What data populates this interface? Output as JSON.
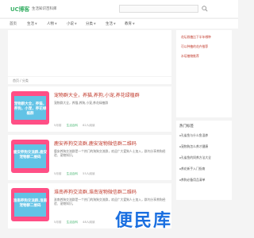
{
  "header": {
    "logo": "UC博客",
    "slogan": "生活知识百科库"
  },
  "nav": [
    "首页",
    "生活",
    "人物",
    "小说",
    "分类",
    "生活",
    "教育"
  ],
  "breadcrumb": "首页 / 分类",
  "cards": [
    {
      "thumb_text": "宠物群大全，养猫，养狗，小宠，养花绿植群",
      "title": "宠物群大全，养猫,养狗,小宠,养花绿植群",
      "desc": "宠物群大全，养猫,养狗,小宠,养花绿植群",
      "meta": [
        "5月前",
        "生活百科",
        "62人阅读"
      ]
    },
    {
      "thumb_text": "鹿安养狗交流群,鹿安宠物群二维码",
      "title": "鹿安养狗交流群,鹿安宠物微信群二维码",
      "desc": "鹿安养狗交流群是一个热门的狗狗交流群，欢迎广大爱狗人士加入，群内分享养狗经验、宠物知识。",
      "meta": [
        "5月前",
        "生活百科",
        "55人阅读"
      ]
    },
    {
      "thumb_text": "淮南养狗交流群,淮南宠物群二维码",
      "title": "淮南养狗交流群,淮南宠物微信群二维码",
      "desc": "淮南养狗交流群是一个热门的狗狗交流群，欢迎广大爱狗人士加入，群内分享养狗经验、宠物知识。",
      "meta": [
        "5月前",
        "生活百科",
        "48人阅读"
      ]
    }
  ],
  "sidebar": {
    "top_links": [
      "花坛栽植比下半年哪种",
      "可以种植的花卉推荐",
      "水培植物推荐"
    ],
    "hot_title": "热门标签",
    "hot_items": [
      "孔雀鱼与什么鱼混养",
      "宠物狗怎么养才健康",
      "孔雀鱼的饲养方法大全",
      "养花新手入门指南",
      "养狗必备用品清单"
    ]
  },
  "watermark": "便民库",
  "colors": {
    "accent": "#3fb36b",
    "title_red": "#c0392b",
    "thumb_pink": "#ff4f86",
    "thumb_blue": "#62c3e6",
    "watermark_blue": "#1a6fe0"
  }
}
